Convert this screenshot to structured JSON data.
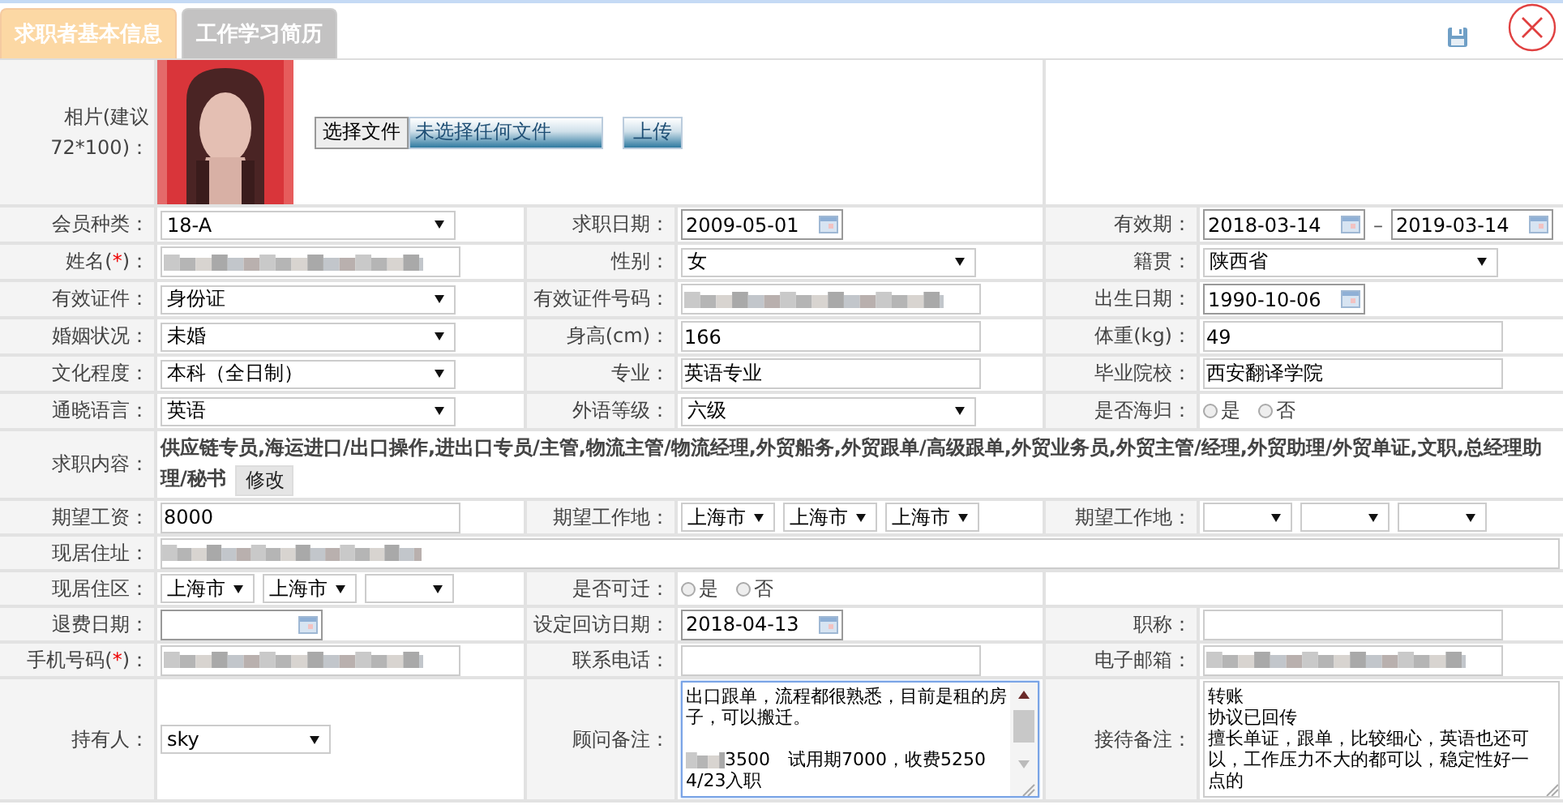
{
  "tabs": [
    {
      "label": "求职者基本信息",
      "selected": true
    },
    {
      "label": "工作学习简历",
      "selected": false
    }
  ],
  "rows": [
    {
      "label": {
        "text": "相片(建议72*100)："
      },
      "choose_button": "选择文件",
      "file_status": "未选择任何文件",
      "upload_button": "上传"
    },
    {
      "kind": "pairs",
      "pairs": [
        {
          "label": {
            "text": "会员种类："
          },
          "field": {
            "kind": "select",
            "value": "18-A"
          }
        },
        {
          "label": {
            "text": "求职日期："
          },
          "field": {
            "kind": "date",
            "value": "2009-05-01"
          }
        },
        {
          "label": {
            "text": "有效期："
          },
          "field": {
            "kind": "date-range",
            "from": "2018-03-14",
            "separator": "–",
            "to": "2019-03-14"
          }
        }
      ]
    },
    {
      "kind": "pairs",
      "pairs": [
        {
          "label": {
            "text": "姓名(",
            "mark": "*",
            "after": ")："
          },
          "field": {
            "kind": "blurred"
          }
        },
        {
          "label": {
            "text": "性别："
          },
          "field": {
            "kind": "select",
            "value": "女"
          }
        },
        {
          "label": {
            "text": "籍贯："
          },
          "field": {
            "kind": "select",
            "value": "陕西省"
          }
        }
      ]
    },
    {
      "kind": "pairs",
      "pairs": [
        {
          "label": {
            "text": "有效证件："
          },
          "field": {
            "kind": "select",
            "value": "身份证"
          }
        },
        {
          "label": {
            "text": "有效证件号码："
          },
          "field": {
            "kind": "blurred"
          }
        },
        {
          "label": {
            "text": "出生日期："
          },
          "field": {
            "kind": "date",
            "value": "1990-10-06"
          }
        }
      ]
    },
    {
      "kind": "pairs",
      "pairs": [
        {
          "label": {
            "text": "婚姻状况："
          },
          "field": {
            "kind": "select",
            "value": "未婚"
          }
        },
        {
          "label": {
            "text": "身高(cm)："
          },
          "field": {
            "kind": "text",
            "value": "166"
          }
        },
        {
          "label": {
            "text": "体重(kg)："
          },
          "field": {
            "kind": "text",
            "value": "49"
          }
        }
      ]
    },
    {
      "kind": "pairs",
      "pairs": [
        {
          "label": {
            "text": "文化程度："
          },
          "field": {
            "kind": "select",
            "value": "本科（全日制）"
          }
        },
        {
          "label": {
            "text": "专业："
          },
          "field": {
            "kind": "text",
            "value": "英语专业"
          }
        },
        {
          "label": {
            "text": "毕业院校："
          },
          "field": {
            "kind": "text",
            "value": "西安翻译学院"
          }
        }
      ]
    },
    {
      "kind": "pairs",
      "pairs": [
        {
          "label": {
            "text": "通晓语言："
          },
          "field": {
            "kind": "select",
            "value": "英语"
          }
        },
        {
          "label": {
            "text": "外语等级："
          },
          "field": {
            "kind": "select",
            "value": "六级"
          }
        },
        {
          "label": {
            "text": "是否海归："
          },
          "field": {
            "kind": "radio",
            "options": [
              {
                "label": "是",
                "selected": false
              },
              {
                "label": "否",
                "selected": false
              }
            ]
          }
        }
      ]
    },
    {
      "kind": "wide",
      "label": {
        "text": "求职内容："
      },
      "field": {
        "kind": "summary",
        "text": "供应链专员,海运进口/出口操作,进出口专员/主管,物流主管/物流经理,外贸船务,外贸跟单/高级跟单,外贸业务员,外贸主管/经理,外贸助理/外贸单证,文职,总经理助理/秘书",
        "button": "修改"
      }
    },
    {
      "kind": "pairs",
      "pairs": [
        {
          "label": {
            "text": "期望工资："
          },
          "field": {
            "kind": "text",
            "value": "8000"
          }
        },
        {
          "label": {
            "text": "期望工作地："
          },
          "field": {
            "kind": "select-group",
            "items": [
              {
                "kind": "select",
                "value": "上海市"
              },
              {
                "kind": "select",
                "value": "上海市"
              },
              {
                "kind": "select",
                "value": "上海市"
              }
            ]
          }
        },
        {
          "label": {
            "text": "期望工作地："
          },
          "field": {
            "kind": "select-group",
            "items": [
              {
                "kind": "select"
              },
              {
                "kind": "select"
              },
              {
                "kind": "select"
              }
            ]
          }
        }
      ]
    },
    {
      "kind": "wide",
      "label": {
        "text": "现居住址："
      },
      "field": {
        "kind": "blurred"
      }
    },
    {
      "kind": "pairs",
      "pairs": [
        {
          "label": {
            "text": "现居住区："
          },
          "field": {
            "kind": "select-group",
            "items": [
              {
                "kind": "select",
                "value": "上海市"
              },
              {
                "kind": "select",
                "value": "上海市"
              },
              {
                "kind": "select"
              }
            ]
          }
        },
        {
          "label": {
            "text": "是否可迁："
          },
          "field": {
            "kind": "radio",
            "options": [
              {
                "label": "是",
                "selected": false
              },
              {
                "label": "否",
                "selected": false
              }
            ]
          }
        }
      ]
    },
    {
      "kind": "pairs",
      "pairs": [
        {
          "label": {
            "text": "退费日期："
          },
          "field": {
            "kind": "date"
          }
        },
        {
          "label": {
            "text": "设定回访日期："
          },
          "field": {
            "kind": "date",
            "value": "2018-04-13"
          }
        },
        {
          "label": {
            "text": "职称："
          },
          "field": {
            "kind": "text"
          }
        }
      ]
    },
    {
      "kind": "pairs",
      "pairs": [
        {
          "label": {
            "text": "手机号码(",
            "mark": "*",
            "after": ")："
          },
          "field": {
            "kind": "blurred"
          }
        },
        {
          "label": {
            "text": "联系电话："
          },
          "field": {
            "kind": "text"
          }
        },
        {
          "label": {
            "text": "电子邮箱："
          },
          "field": {
            "kind": "blurred"
          }
        }
      ]
    },
    {
      "kind": "notes",
      "pairs": [
        {
          "label": {
            "text": "持有人："
          },
          "field": {
            "kind": "select",
            "value": "sky"
          }
        },
        {
          "label": {
            "text": "顾问备注："
          },
          "field": {
            "kind": "textarea",
            "focused": true,
            "scrollable": true,
            "paragraphs": [
              {
                "lines": [
                  {
                    "text": "出口跟单，流程都很熟悉，目前是租的房子，可以搬迁。",
                    "redacted": false
                  }
                ]
              },
              {
                "lines": [
                  {
                    "text": "3500　试用期7000，收费5250",
                    "redacted": true
                  },
                  {
                    "text": "4/23入职",
                    "redacted": false
                  }
                ]
              }
            ]
          }
        },
        {
          "label": {
            "text": "接待备注："
          },
          "field": {
            "kind": "textarea",
            "focused": false,
            "scrollable": false,
            "paragraphs": [
              {
                "lines": [
                  {
                    "text": "转账",
                    "redacted": false
                  },
                  {
                    "text": "协议已回传",
                    "redacted": false
                  },
                  {
                    "text": "擅长单证，跟单，比较细心，英语也还可以，工作压力不大的都可以，稳定性好一点的",
                    "redacted": false
                  }
                ]
              }
            ]
          }
        }
      ]
    }
  ]
}
